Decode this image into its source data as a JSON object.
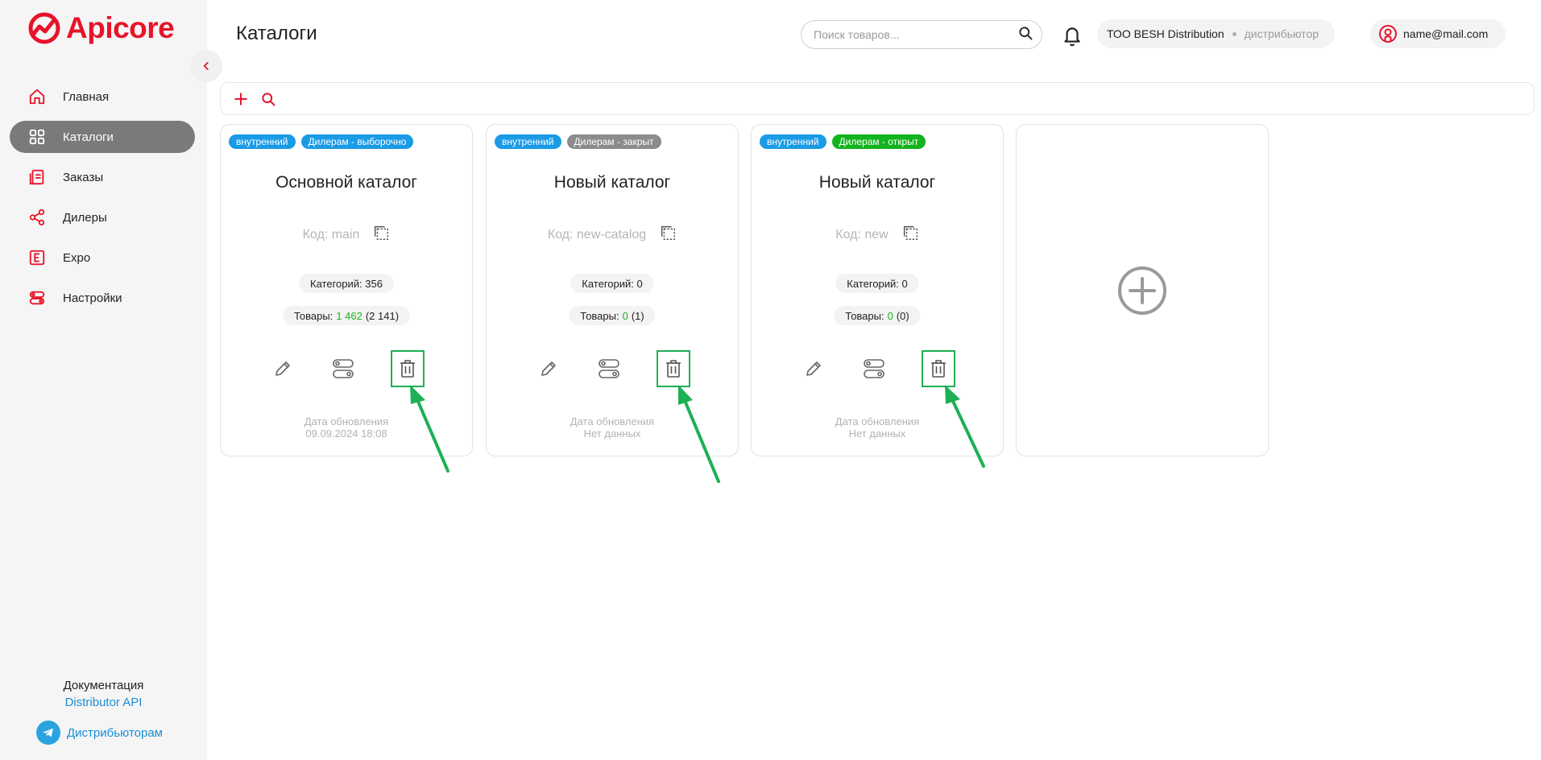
{
  "app": {
    "logo_text": "Apicore",
    "page_title": "Каталоги",
    "brand_color": "#e8132a",
    "accent_green": "#1eb055"
  },
  "sidebar": {
    "items": [
      {
        "label": "Главная",
        "icon": "home-icon",
        "active": false
      },
      {
        "label": "Каталоги",
        "icon": "grid-icon",
        "active": true
      },
      {
        "label": "Заказы",
        "icon": "orders-icon",
        "active": false
      },
      {
        "label": "Дилеры",
        "icon": "share-icon",
        "active": false
      },
      {
        "label": "Expo",
        "icon": "expo-icon",
        "active": false
      },
      {
        "label": "Настройки",
        "icon": "settings-icon",
        "active": false
      }
    ],
    "docs_label": "Документация",
    "docs_link": "Distributor API",
    "telegram_link": "Дистрибьюторам"
  },
  "header": {
    "search_placeholder": "Поиск товаров...",
    "org_name": "ТОО BESH Distribution",
    "org_role": "дистрибьютор",
    "user_email": "name@mail.com"
  },
  "cards": [
    {
      "tags": [
        {
          "label": "внутренний",
          "color": "blue"
        },
        {
          "label": "Дилерам - выборочно",
          "color": "blue"
        }
      ],
      "title": "Основной каталог",
      "code": "Код: main",
      "categories": "Категорий: 356",
      "goods_prefix": "Товары:",
      "goods_active": "1 462",
      "goods_total": "(2 141)",
      "updated_label": "Дата обновления",
      "updated_value": "09.09.2024 18:08"
    },
    {
      "tags": [
        {
          "label": "внутренний",
          "color": "blue"
        },
        {
          "label": "Дилерам - закрыт",
          "color": "gray"
        }
      ],
      "title": "Новый каталог",
      "code": "Код: new-catalog",
      "categories": "Категорий: 0",
      "goods_prefix": "Товары:",
      "goods_active": "0",
      "goods_total": "(1)",
      "updated_label": "Дата обновления",
      "updated_value": "Нет данных"
    },
    {
      "tags": [
        {
          "label": "внутренний",
          "color": "blue"
        },
        {
          "label": "Дилерам - открыт",
          "color": "green"
        }
      ],
      "title": "Новый каталог",
      "code": "Код: new",
      "categories": "Категорий: 0",
      "goods_prefix": "Товары:",
      "goods_active": "0",
      "goods_total": "(0)",
      "updated_label": "Дата обновления",
      "updated_value": "Нет данных"
    }
  ]
}
